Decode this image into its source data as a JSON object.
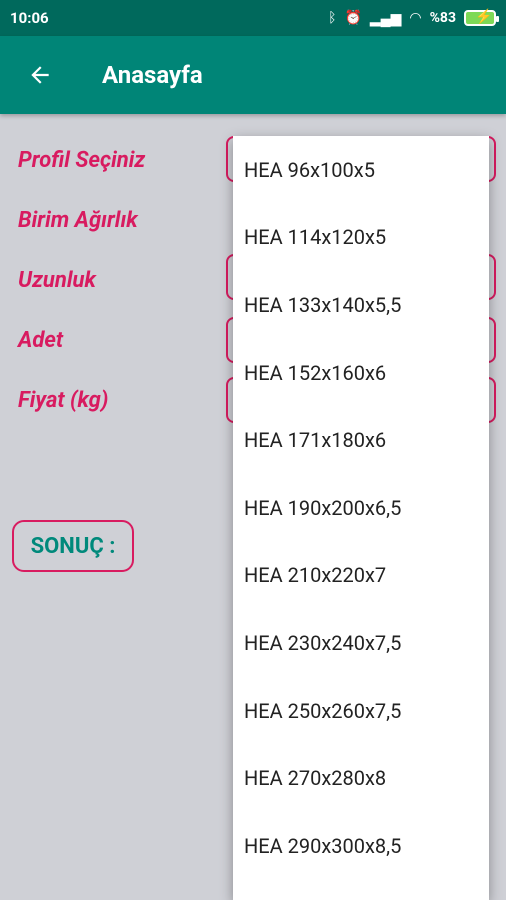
{
  "status": {
    "time": "10:06",
    "battery": "%83",
    "icons": [
      "bluetooth-icon",
      "alarm-icon",
      "signal-icon",
      "wifi-icon",
      "battery-icon"
    ]
  },
  "appbar": {
    "title": "Anasayfa"
  },
  "form": {
    "labels": [
      "Profil Seçiniz",
      "Birim Ağırlık",
      "Uzunluk",
      "Adet",
      "Fiyat (kg)"
    ],
    "result_label": "SONUÇ :"
  },
  "dropdown": {
    "items": [
      "HEA 96x100x5",
      "HEA 114x120x5",
      "HEA 133x140x5,5",
      "HEA 152x160x6",
      "HEA 171x180x6",
      "HEA 190x200x6,5",
      "HEA 210x220x7",
      "HEA 230x240x7,5",
      "HEA 250x260x7,5",
      "HEA 270x280x8",
      "HEA 290x300x8,5"
    ]
  },
  "colors": {
    "primary": "#008577",
    "primary_dark": "#00695c",
    "accent": "#d81b60",
    "background": "#cfd0d6"
  }
}
